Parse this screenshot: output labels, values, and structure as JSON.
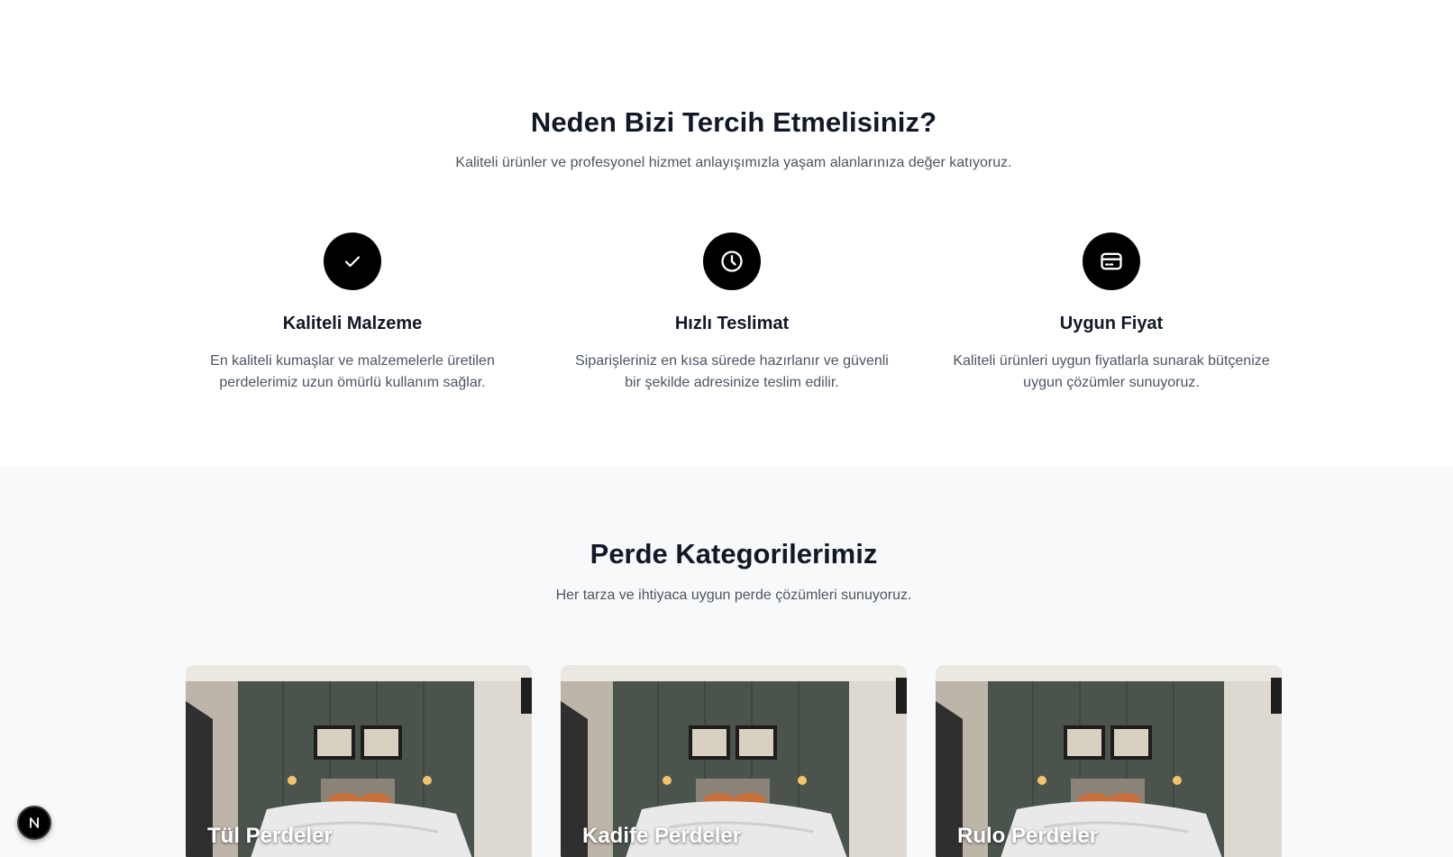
{
  "why": {
    "title": "Neden Bizi Tercih Etmelisiniz?",
    "subtitle": "Kaliteli ürünler ve profesyonel hizmet anlayışımızla yaşam alanlarınıza değer katıyoruz.",
    "features": [
      {
        "icon": "check-icon",
        "title": "Kaliteli Malzeme",
        "desc": "En kaliteli kumaşlar ve malzemelerle üretilen perdelerimiz uzun ömürlü kullanım sağlar."
      },
      {
        "icon": "clock-icon",
        "title": "Hızlı Teslimat",
        "desc": "Siparişleriniz en kısa sürede hazırlanır ve güvenli bir şekilde adresinize teslim edilir."
      },
      {
        "icon": "credit-card-icon",
        "title": "Uygun Fiyat",
        "desc": "Kaliteli ürünleri uygun fiyatlarla sunarak bütçenize uygun çözümler sunuyoruz."
      }
    ]
  },
  "categories": {
    "title": "Perde Kategorilerimiz",
    "subtitle": "Her tarza ve ihtiyaca uygun perde çözümleri sunuyoruz.",
    "items": [
      {
        "label": "Tül Perdeler"
      },
      {
        "label": "Kadife Perdeler"
      },
      {
        "label": "Rulo Perdeler"
      }
    ]
  },
  "devtools": {
    "badge_letter": "N"
  },
  "colors": {
    "icon_bg": "#000000",
    "section_alt_bg": "#f8f9fa",
    "heading": "#111827",
    "body_text": "#4b5563"
  }
}
